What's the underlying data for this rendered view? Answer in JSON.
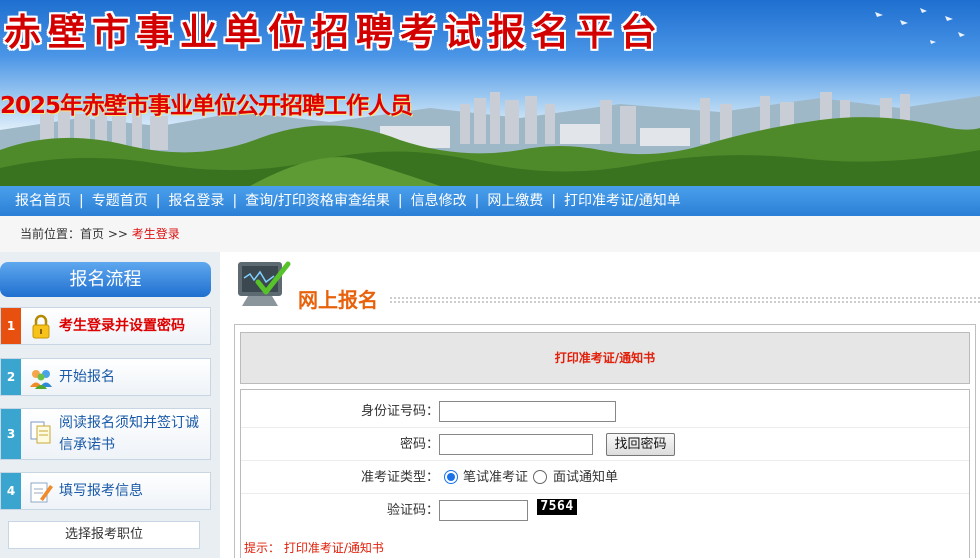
{
  "header": {
    "site_title": "赤壁市事业单位招聘考试报名平台",
    "subtitle": "2025年赤壁市事业单位公开招聘工作人员"
  },
  "nav": {
    "items": [
      "报名首页",
      "专题首页",
      "报名登录",
      "查询/打印资格审查结果",
      "信息修改",
      "网上缴费",
      "打印准考证/通知单"
    ],
    "separator": "|"
  },
  "breadcrumb": {
    "prefix": "当前位置：首页 >> ",
    "current": "考生登录"
  },
  "sidebar": {
    "title": "报名流程",
    "steps": [
      {
        "num": "1",
        "label": "考生登录并设置密码",
        "icon": "lock-icon",
        "active": true
      },
      {
        "num": "2",
        "label": "开始报名",
        "icon": "users-icon",
        "active": false
      },
      {
        "num": "3",
        "label_line1": "阅读报名须知并签订诚",
        "label_line2": "信承诺书",
        "icon": "documents-icon",
        "active": false
      },
      {
        "num": "4",
        "label": "填写报考信息",
        "icon": "edit-icon",
        "active": false
      }
    ],
    "sub_item": "选择报考职位"
  },
  "main": {
    "section_title": "网上报名",
    "panel_title": "打印准考证/通知书",
    "form": {
      "id_label": "身份证号码：",
      "id_value": "",
      "password_label": "密码：",
      "password_value": "",
      "find_password_button": "找回密码",
      "ticket_type_label": "准考证类型：",
      "ticket_options": [
        {
          "label": "笔试准考证",
          "selected": true
        },
        {
          "label": "面试通知单",
          "selected": false
        }
      ],
      "captcha_label": "验证码：",
      "captcha_value": "",
      "captcha_image_text": "7564"
    },
    "tip": "提示： 打印准考证/通知书"
  },
  "colors": {
    "accent_red": "#d30000",
    "nav_blue": "#2b7fd6",
    "title_orange": "#e8620c",
    "active_step": "#e85010"
  }
}
